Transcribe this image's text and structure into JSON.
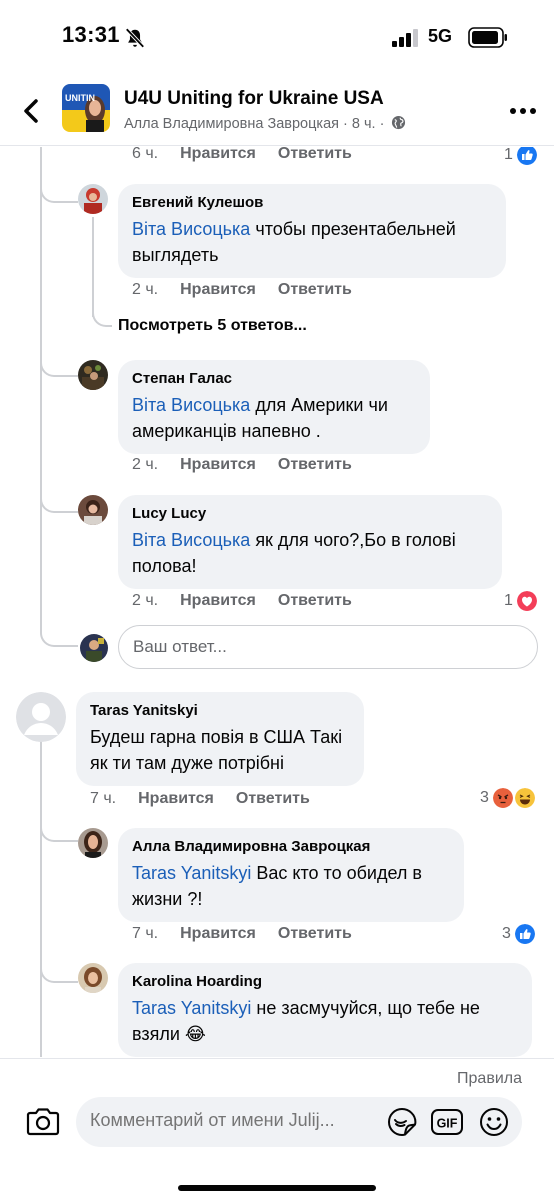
{
  "status_bar": {
    "time": "13:31",
    "network": "5G"
  },
  "header": {
    "title": "U4U Uniting for Ukraine USA",
    "subtitle": "Алла Владимировна Завроцкая · 8 ч. ·",
    "avatar_text": "UNITIN"
  },
  "comments": [
    {
      "time": "6 ч.",
      "like": "Нравится",
      "reply": "Ответить",
      "reactions": "1"
    },
    {
      "author": "Евгений Кулешов",
      "mention": "Віта Висоцька",
      "text": " чтобы презентабельней выглядеть",
      "time": "2 ч.",
      "like": "Нравится",
      "reply": "Ответить"
    },
    {
      "view_replies": "Посмотреть 5 ответов..."
    },
    {
      "author": "Степан Галас",
      "mention": "Віта Висоцька",
      "text": " для Америки чи американців напевно .",
      "time": "2 ч.",
      "like": "Нравится",
      "reply": "Ответить"
    },
    {
      "author": "Lucy Lucy",
      "mention": "Віта Висоцька",
      "text": " як для чого?,Бо в голові полова!",
      "time": "2 ч.",
      "like": "Нравится",
      "reply": "Ответить",
      "reactions": "1"
    },
    {
      "reply_placeholder": "Ваш ответ..."
    },
    {
      "author": "Taras Yanitskyi",
      "text": "Будеш гарна повія в США Такі як ти там дуже потрібні",
      "time": "7 ч.",
      "like": "Нравится",
      "reply": "Ответить",
      "reactions": "3"
    },
    {
      "author": "Алла Владимировна Завроцкая",
      "mention": "Taras Yanitskyi",
      "text": " Вас кто то обидел в жизни ?!",
      "time": "7 ч.",
      "like": "Нравится",
      "reply": "Ответить",
      "reactions": "3"
    },
    {
      "author": "Karolina Hoarding",
      "mention": "Taras Yanitskyi",
      "text": " не засмучуйся, що тебе не взяли 😂"
    }
  ],
  "footer": {
    "rules": "Правила",
    "composer_placeholder": "Комментарий от имени Julij...",
    "gif_label": "GIF"
  },
  "colors": {
    "mention": "#1b5fb8",
    "like_blue": "#1877f2",
    "love_red": "#f33e58",
    "bubble": "#f0f2f5"
  }
}
